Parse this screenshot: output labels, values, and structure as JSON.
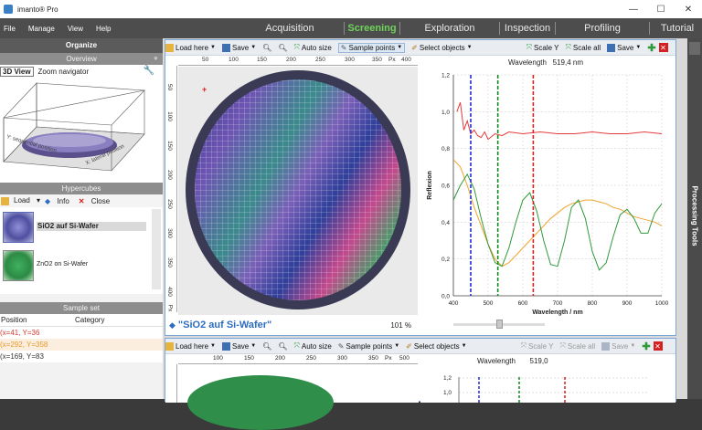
{
  "app": {
    "title": "imanto® Pro"
  },
  "window_controls": {
    "minimize": "—",
    "maximize": "☐",
    "close": "✕"
  },
  "menu": [
    "File",
    "Manage",
    "View",
    "Help"
  ],
  "modes": [
    {
      "label": "Acquisition",
      "active": false
    },
    {
      "label": "Screening",
      "active": true
    },
    {
      "label": "Exploration",
      "active": false
    },
    {
      "label": "Inspection",
      "active": false
    },
    {
      "label": "Profiling",
      "active": false
    },
    {
      "label": "Tutorial",
      "active": false
    }
  ],
  "organize": {
    "title": "Organize",
    "overview": {
      "title": "Overview",
      "pin": "ᵠ",
      "tabs": [
        "3D View",
        "Zoom navigator"
      ],
      "axis_y": "Y: sequential position",
      "axis_x": "X: lateral position"
    },
    "hypercubes": {
      "title": "Hypercubes",
      "load": "Load",
      "info": "Info",
      "close": "Close",
      "items": [
        {
          "name": "SiO2 auf Si-Wafer",
          "selected": true
        },
        {
          "name": "ZnO2 on Si-Wafer",
          "selected": false
        }
      ]
    },
    "sample_set": {
      "title": "Sample set",
      "columns": [
        "Position",
        "Category"
      ],
      "rows": [
        {
          "position": "(x=41, Y=36",
          "color": "#d43a2a"
        },
        {
          "position": "(x=292, Y=358",
          "color": "#e79a2c"
        },
        {
          "position": "(x=169, Y=83",
          "color": "#333333"
        }
      ]
    }
  },
  "toolbar": {
    "load_here": "Load here",
    "save": "Save",
    "auto_size": "Auto size",
    "sample_points": "Sample points",
    "select_objects": "Select objects",
    "scale_y": "Scale Y",
    "scale_all": "Scale all"
  },
  "top_window": {
    "ruler_x": [
      "50",
      "100",
      "150",
      "200",
      "250",
      "300",
      "350",
      "Px",
      "400"
    ],
    "ruler_y": [
      "50",
      "100",
      "150",
      "200",
      "250",
      "300",
      "350",
      "400",
      "Px"
    ],
    "sample_name": "\"SiO2 auf Si-Wafer\"",
    "zoom": "101 %",
    "wavelength_label": "Wavelength",
    "wavelength_value": "519,4 nm"
  },
  "bottom_window": {
    "ruler_x": [
      "100",
      "150",
      "200",
      "250",
      "300",
      "350",
      "Px",
      "500"
    ],
    "wavelength_label": "Wavelength",
    "wavelength_value": "519,0",
    "y_ticks": [
      "1,2",
      "1,0"
    ]
  },
  "processing_tools": {
    "label": "Processing Tools"
  },
  "chart_data": {
    "type": "line",
    "xlabel": "Wavelength / nm",
    "ylabel": "Reflexion",
    "xlim": [
      400,
      1000
    ],
    "ylim": [
      0,
      1.2
    ],
    "x_ticks": [
      "400",
      "500",
      "600",
      "700",
      "800",
      "900",
      "1000"
    ],
    "y_ticks": [
      "0,0",
      "0,2",
      "0,4",
      "0,6",
      "0,8",
      "1,0",
      "1,2"
    ],
    "grid": true,
    "markers": [
      {
        "x": 450,
        "color": "#1f2fd6"
      },
      {
        "x": 528,
        "color": "#138a1f"
      },
      {
        "x": 630,
        "color": "#d42020"
      }
    ],
    "series": [
      {
        "color": "#e33b3b",
        "x": [
          410,
          420,
          430,
          440,
          450,
          460,
          470,
          480,
          490,
          500,
          520,
          540,
          560,
          600,
          650,
          700,
          750,
          800,
          850,
          900,
          950,
          1000
        ],
        "y": [
          1.0,
          1.05,
          0.9,
          0.95,
          0.88,
          0.9,
          0.87,
          0.86,
          0.89,
          0.85,
          0.88,
          0.87,
          0.89,
          0.88,
          0.89,
          0.88,
          0.88,
          0.89,
          0.88,
          0.88,
          0.89,
          0.88
        ]
      },
      {
        "color": "#f0a32c",
        "x": [
          400,
          420,
          440,
          460,
          480,
          500,
          520,
          540,
          560,
          580,
          600,
          620,
          640,
          660,
          680,
          700,
          720,
          740,
          760,
          780,
          800,
          820,
          840,
          860,
          880,
          900,
          920,
          940,
          960,
          980,
          1000
        ],
        "y": [
          0.74,
          0.7,
          0.6,
          0.48,
          0.38,
          0.28,
          0.2,
          0.16,
          0.18,
          0.22,
          0.26,
          0.3,
          0.34,
          0.38,
          0.42,
          0.45,
          0.48,
          0.5,
          0.51,
          0.52,
          0.52,
          0.51,
          0.5,
          0.48,
          0.47,
          0.45,
          0.43,
          0.42,
          0.41,
          0.4,
          0.38
        ]
      },
      {
        "color": "#2f9a3a",
        "x": [
          400,
          420,
          440,
          460,
          480,
          500,
          520,
          540,
          560,
          580,
          600,
          620,
          640,
          660,
          680,
          700,
          720,
          740,
          760,
          780,
          800,
          820,
          840,
          860,
          880,
          900,
          920,
          940,
          960,
          980,
          1000
        ],
        "y": [
          0.52,
          0.6,
          0.66,
          0.58,
          0.42,
          0.28,
          0.18,
          0.16,
          0.26,
          0.4,
          0.52,
          0.56,
          0.46,
          0.3,
          0.17,
          0.16,
          0.3,
          0.48,
          0.52,
          0.42,
          0.24,
          0.14,
          0.18,
          0.32,
          0.44,
          0.47,
          0.42,
          0.34,
          0.34,
          0.45,
          0.5
        ]
      }
    ]
  },
  "colors": {
    "accent_green": "#6fd35a",
    "dark_bg": "#4d4d4d",
    "window_border": "#7aa7d6",
    "link_blue": "#2c6dbf"
  }
}
